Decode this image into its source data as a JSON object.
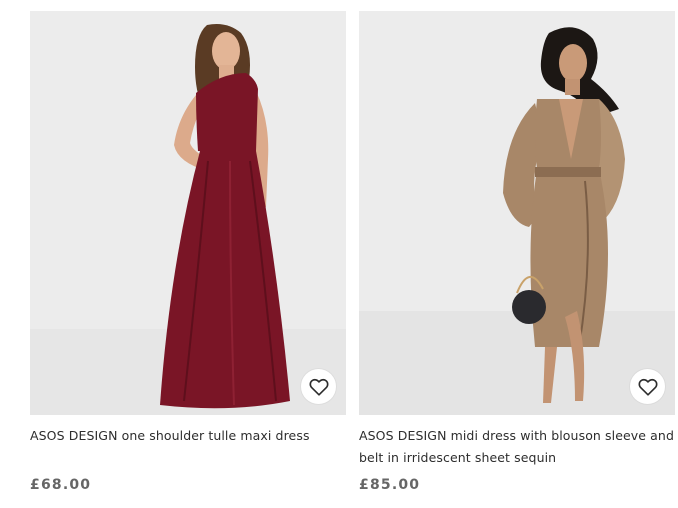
{
  "products": [
    {
      "title": "ASOS DESIGN one shoulder tulle maxi dress",
      "price": "£68.00",
      "dress_color": "#7a1526",
      "image_alt": "Model wearing burgundy one shoulder tulle maxi dress"
    },
    {
      "title": "ASOS DESIGN midi dress with blouson sleeve and belt in irridescent sheet sequin",
      "price": "£85.00",
      "dress_color": "#a88768",
      "image_alt": "Model wearing iridescent sequin midi dress with blouson sleeves"
    }
  ],
  "icons": {
    "save": "heart-icon"
  },
  "colors": {
    "text": "#2d2d2d",
    "price": "#666666",
    "image_bg": "#ececec"
  }
}
